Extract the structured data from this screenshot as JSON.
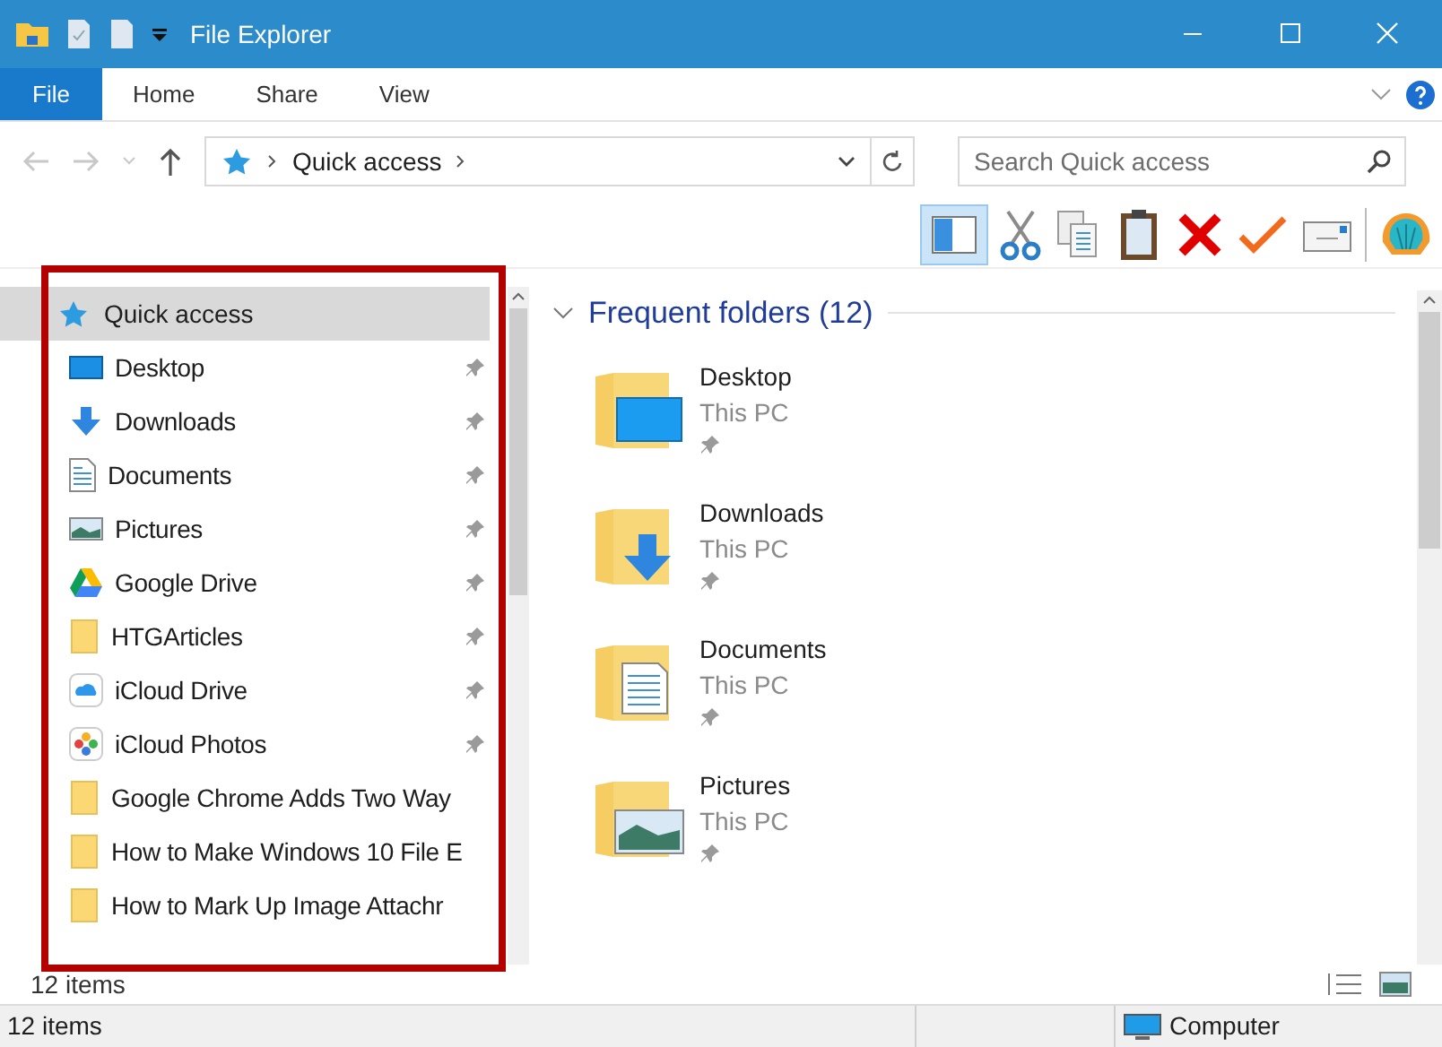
{
  "window": {
    "title": "File Explorer"
  },
  "ribbon": {
    "tabs": [
      {
        "label": "File",
        "kind": "file"
      },
      {
        "label": "Home",
        "kind": "tab"
      },
      {
        "label": "Share",
        "kind": "tab"
      },
      {
        "label": "View",
        "kind": "tab"
      }
    ]
  },
  "address_bar": {
    "path": "Quick access"
  },
  "search": {
    "placeholder": "Search Quick access"
  },
  "navigation": {
    "header": {
      "label": "Quick access",
      "selected": true
    },
    "items": [
      {
        "label": "Desktop",
        "kind": "desktop",
        "pinned": true
      },
      {
        "label": "Downloads",
        "kind": "downloads",
        "pinned": true
      },
      {
        "label": "Documents",
        "kind": "documents",
        "pinned": true
      },
      {
        "label": "Pictures",
        "kind": "pictures",
        "pinned": true
      },
      {
        "label": "Google Drive",
        "kind": "drive",
        "pinned": true
      },
      {
        "label": "HTGArticles",
        "kind": "folder",
        "pinned": true
      },
      {
        "label": "iCloud Drive",
        "kind": "cloud",
        "pinned": true
      },
      {
        "label": "iCloud Photos",
        "kind": "photos",
        "pinned": true
      },
      {
        "label": "Google Chrome Adds Two Way",
        "kind": "folder",
        "pinned": false
      },
      {
        "label": "How to Make Windows 10 File E",
        "kind": "folder",
        "pinned": false
      },
      {
        "label": "How to Mark Up Image Attachr",
        "kind": "folder",
        "pinned": false
      }
    ]
  },
  "content": {
    "group": {
      "title": "Frequent folders (12)",
      "expanded": true
    },
    "folders": [
      {
        "name": "Desktop",
        "location": "This PC",
        "kind": "desktop",
        "pinned": true
      },
      {
        "name": "Downloads",
        "location": "This PC",
        "kind": "downloads",
        "pinned": true
      },
      {
        "name": "Documents",
        "location": "This PC",
        "kind": "documents",
        "pinned": true
      },
      {
        "name": "Pictures",
        "location": "This PC",
        "kind": "pictures",
        "pinned": true
      }
    ]
  },
  "status_bar": {
    "count": "12 items"
  },
  "bottom_bar": {
    "count": "12 items",
    "location": "Computer"
  }
}
